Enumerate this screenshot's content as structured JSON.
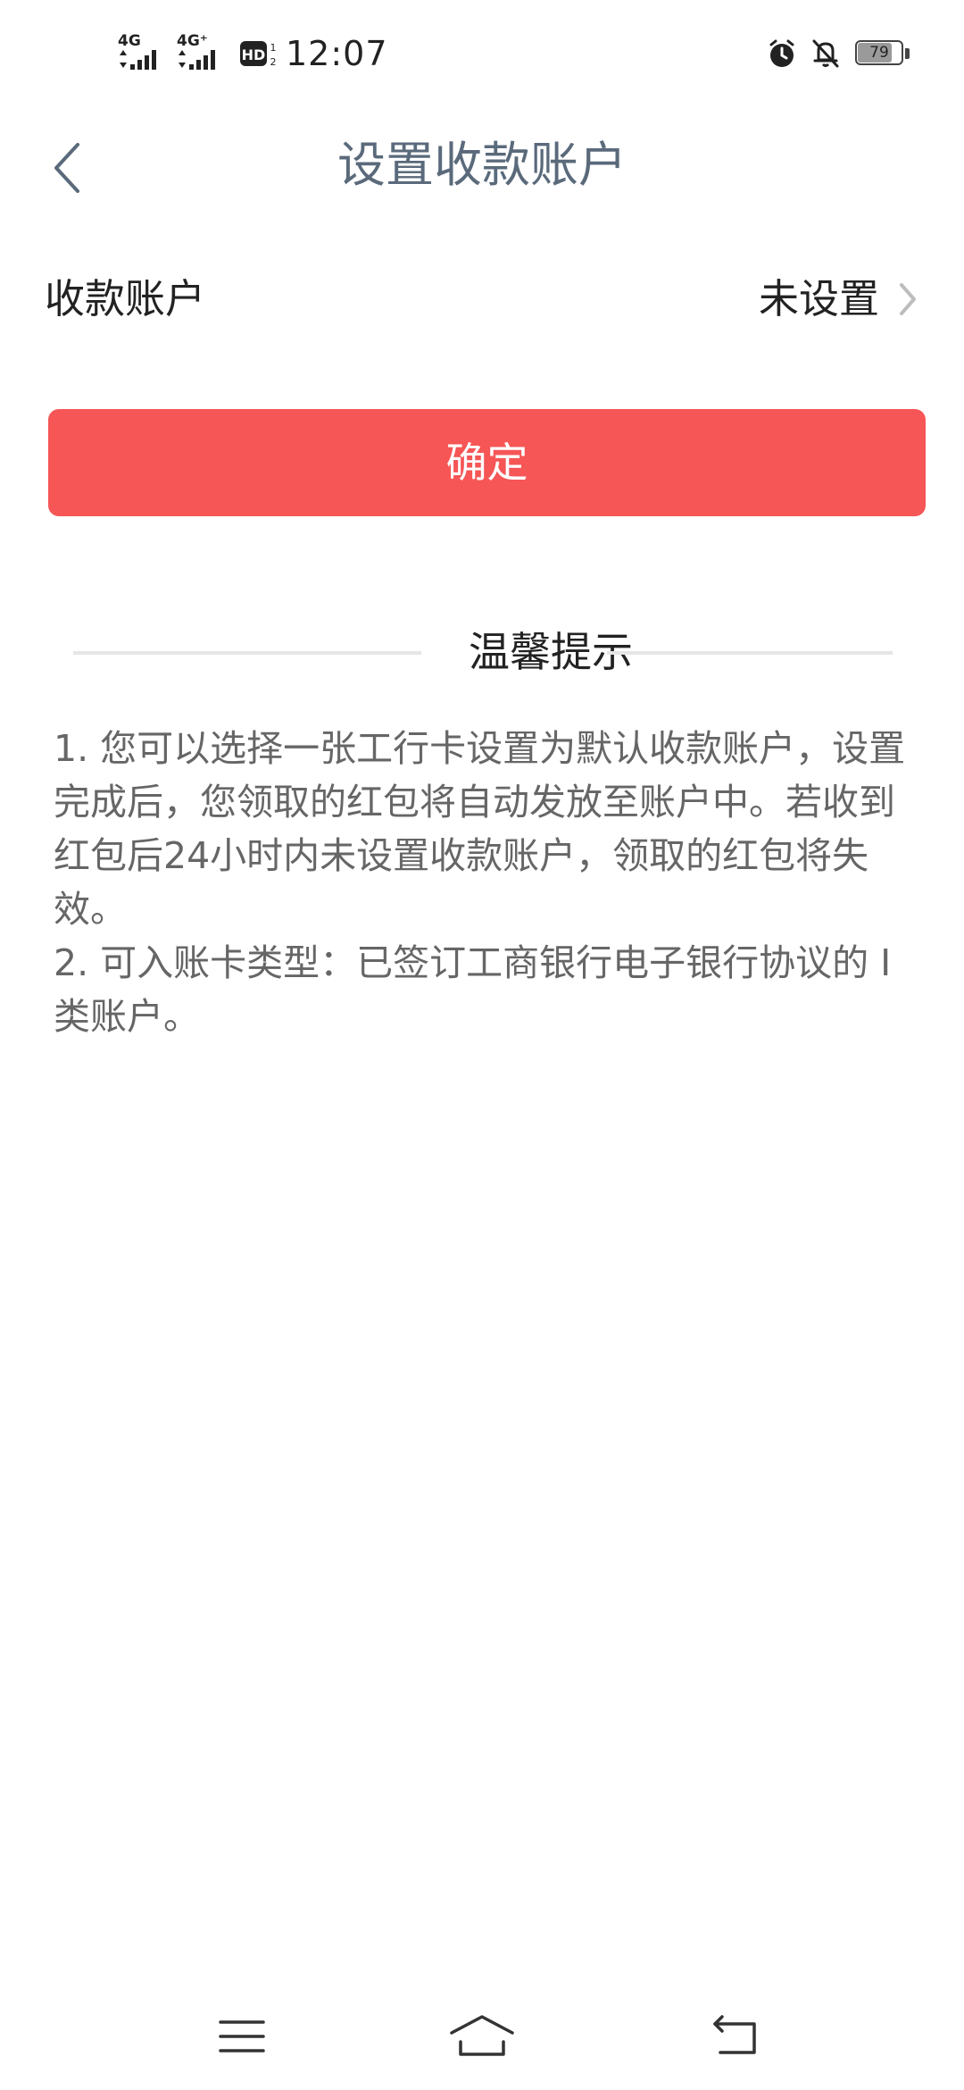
{
  "status_bar": {
    "network1": "4G",
    "network2": "4G⁺",
    "hd_badge": "HD",
    "time": "12:07",
    "battery_level": "79",
    "battery_fraction": 0.79,
    "icons": [
      "signal-icon",
      "hd-volte-icon",
      "alarm-icon",
      "notifications-off-icon",
      "battery-icon"
    ]
  },
  "header": {
    "title": "设置收款账户",
    "back_icon": "chevron-left-icon"
  },
  "account_row": {
    "label": "收款账户",
    "value": "未设置",
    "chevron_icon": "chevron-right-icon"
  },
  "confirm_button": {
    "label": "确定",
    "color": "#f65656"
  },
  "tips": {
    "title": "温馨提示",
    "items": [
      "1. 您可以选择一张工行卡设置为默认收款账户，设置完成后，您领取的红包将自动发放至账户中。若收到红包后24小时内未设置收款账户，领取的红包将失效。",
      "2. 可入账卡类型：已签订工商银行电子银行协议的 I 类账户。"
    ]
  },
  "bottom_nav": {
    "icons": [
      "menu-icon",
      "home-icon",
      "back-icon"
    ]
  }
}
